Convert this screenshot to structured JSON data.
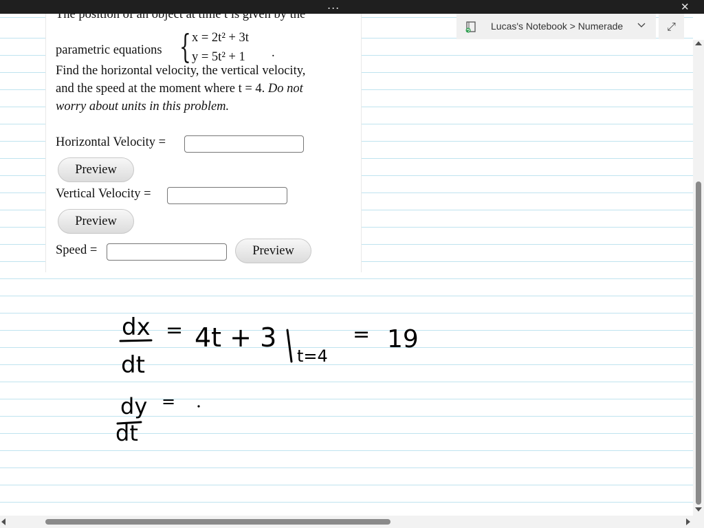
{
  "window": {
    "dots": "...",
    "close": "✕"
  },
  "notebook": {
    "breadcrumb": "Lucas's Notebook > Numerade",
    "expand": "⤢"
  },
  "problem": {
    "intro": "The position of an object at time t is given by the",
    "eq_label": "parametric equations",
    "eq_x": "x = 2t² + 3t",
    "eq_y": "y = 5t² + 1",
    "line1": "Find the horizontal velocity, the vertical velocity,",
    "line2": "and the speed at the moment where t = 4.",
    "line2_italic": "Do not",
    "line3": "worry about units in this problem."
  },
  "fields": [
    {
      "label": "Horizontal Velocity =",
      "value": ""
    },
    {
      "label": "Vertical Velocity =",
      "value": ""
    },
    {
      "label": "Speed =",
      "value": ""
    }
  ],
  "preview_label": "Preview",
  "handwriting": {
    "dx": "dx",
    "dt": "dt",
    "eq_sign": "=",
    "expr": "4t + 3",
    "eval_point": "t=4",
    "result": "19",
    "dy": "dy"
  },
  "colors": {
    "ink": "#000000",
    "rule": "#bfe3ef",
    "titlebar": "#1f1f1f"
  }
}
